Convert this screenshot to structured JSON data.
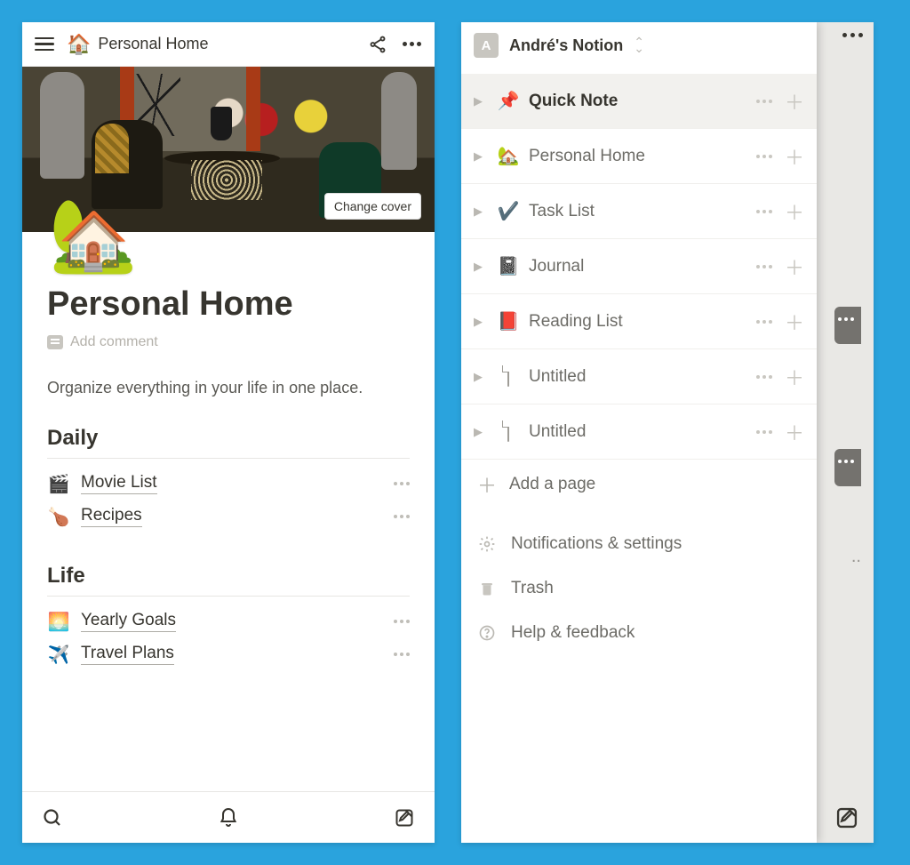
{
  "phone1": {
    "topbar": {
      "icon": "🏠",
      "title": "Personal Home"
    },
    "cover": {
      "change_label": "Change cover",
      "hero_emoji": "🏡"
    },
    "page": {
      "title": "Personal Home",
      "add_comment": "Add comment",
      "description": "Organize everything in your life in one place.",
      "sections": [
        {
          "heading": "Daily",
          "items": [
            {
              "emoji": "🎬",
              "label": "Movie List"
            },
            {
              "emoji": "🍗",
              "label": "Recipes"
            }
          ]
        },
        {
          "heading": "Life",
          "items": [
            {
              "emoji": "🌅",
              "label": "Yearly Goals"
            },
            {
              "emoji": "✈️",
              "label": "Travel Plans"
            }
          ]
        }
      ]
    }
  },
  "phone2": {
    "workspace": {
      "initial": "A",
      "name": "André's Notion"
    },
    "pages": [
      {
        "emoji": "📌",
        "label": "Quick Note",
        "selected": true
      },
      {
        "emoji": "🏡",
        "label": "Personal Home",
        "selected": false
      },
      {
        "emoji": "✔️",
        "label": "Task List",
        "selected": false
      },
      {
        "emoji": "📓",
        "label": "Journal",
        "selected": false
      },
      {
        "emoji": "📕",
        "label": "Reading List",
        "selected": false
      },
      {
        "emoji": "__file__",
        "label": "Untitled",
        "selected": false
      },
      {
        "emoji": "__file__",
        "label": "Untitled",
        "selected": false
      }
    ],
    "add_page": "Add a page",
    "utils": [
      {
        "icon": "gear",
        "label": "Notifications & settings"
      },
      {
        "icon": "trash",
        "label": "Trash"
      },
      {
        "icon": "help",
        "label": "Help & feedback"
      }
    ]
  }
}
